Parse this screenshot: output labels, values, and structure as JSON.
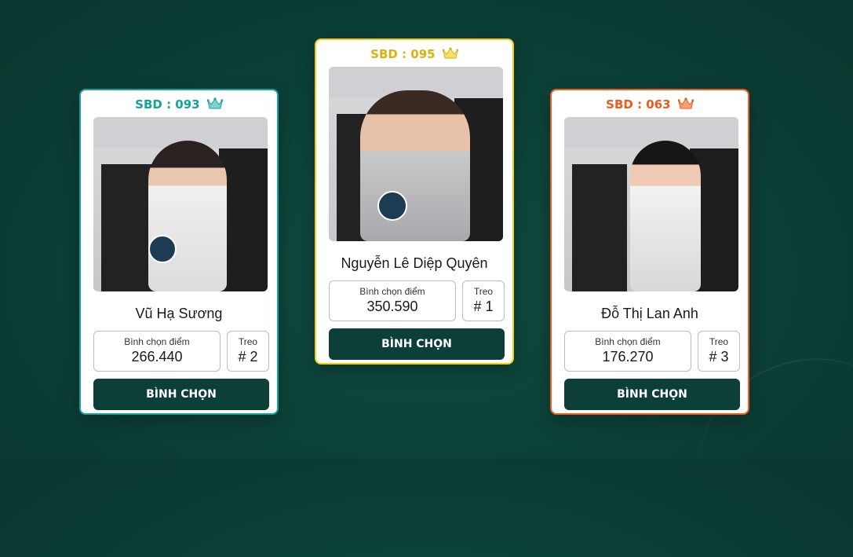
{
  "contestants": [
    {
      "sbd": "SBD : 093",
      "name": "Vũ Hạ Sương",
      "score_label": "Bình chọn điểm",
      "score": "266.440",
      "rank_label": "Treo",
      "rank": "# 2",
      "vote_label": "BÌNH CHỌN",
      "accent": "#13a39c"
    },
    {
      "sbd": "SBD : 095",
      "name": "Nguyễn Lê Diệp Quyên",
      "score_label": "Bình chọn điểm",
      "score": "350.590",
      "rank_label": "Treo",
      "rank": "# 1",
      "vote_label": "BÌNH CHỌN",
      "accent": "#f2cd12"
    },
    {
      "sbd": "SBD : 063",
      "name": "Đỗ Thị Lan Anh",
      "score_label": "Bình chọn điểm",
      "score": "176.270",
      "rank_label": "Treo",
      "rank": "# 3",
      "vote_label": "BÌNH CHỌN",
      "accent": "#ef5a1c"
    }
  ],
  "icons": {
    "crown": "crown-icon"
  },
  "colors": {
    "background": "#0c4037",
    "button": "#0b3f38"
  }
}
